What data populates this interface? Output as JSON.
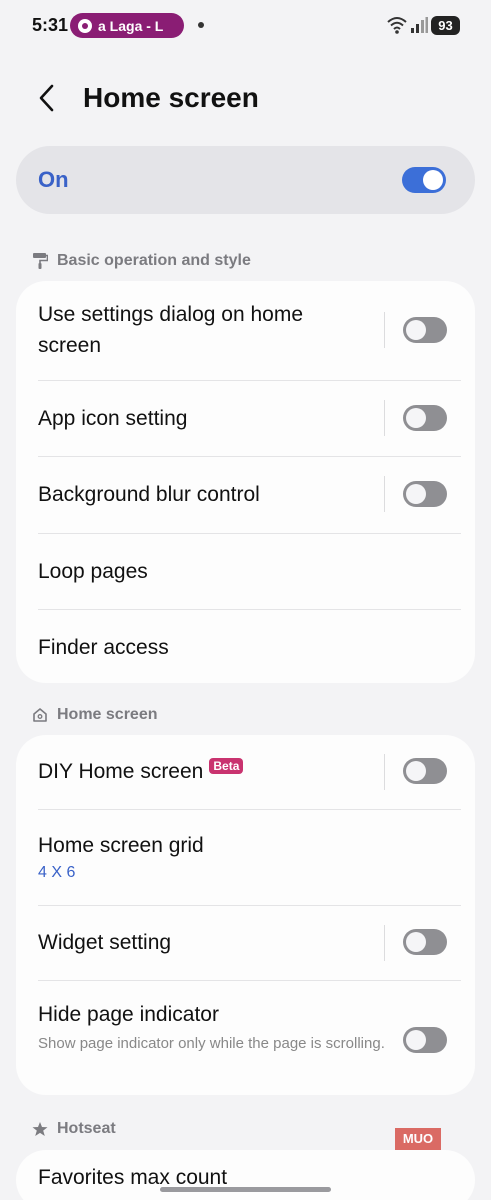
{
  "status_bar": {
    "time": "5:31",
    "media_title": "a Laga - L",
    "battery": "93",
    "icons": [
      "media-icon",
      "wifi-icon",
      "signal-icon",
      "battery-icon"
    ]
  },
  "header": {
    "title": "Home screen",
    "back_icon": "chevron-left-icon"
  },
  "master": {
    "label": "On",
    "enabled": true,
    "accent": "#3c6fd8"
  },
  "sections": {
    "basic": {
      "header": "Basic operation and style",
      "icon": "paint-roller-icon",
      "items": [
        {
          "title": "Use settings dialog on home screen",
          "toggle": false
        },
        {
          "title": "App icon setting",
          "toggle": false
        },
        {
          "title": "Background blur control",
          "toggle": false
        },
        {
          "title": "Loop pages"
        },
        {
          "title": "Finder access"
        }
      ]
    },
    "home": {
      "header": "Home screen",
      "icon": "home-icon",
      "items": [
        {
          "title": "DIY Home screen",
          "badge": "Beta",
          "toggle": false
        },
        {
          "title": "Home screen grid",
          "value": "4 X 6"
        },
        {
          "title": "Widget setting",
          "toggle": false
        },
        {
          "title": "Hide page indicator",
          "description": "Show page indicator only while the page is scrolling.",
          "toggle": false
        }
      ]
    },
    "hotseat": {
      "header": "Hotseat",
      "icon": "star-icon",
      "items": [
        {
          "title": "Favorites max count"
        }
      ]
    }
  },
  "watermark": "MUO",
  "colors": {
    "background": "#f3f3f5",
    "card": "#fdfdfd",
    "accent_blue": "#3a62c8",
    "beta": "#c9336f"
  }
}
